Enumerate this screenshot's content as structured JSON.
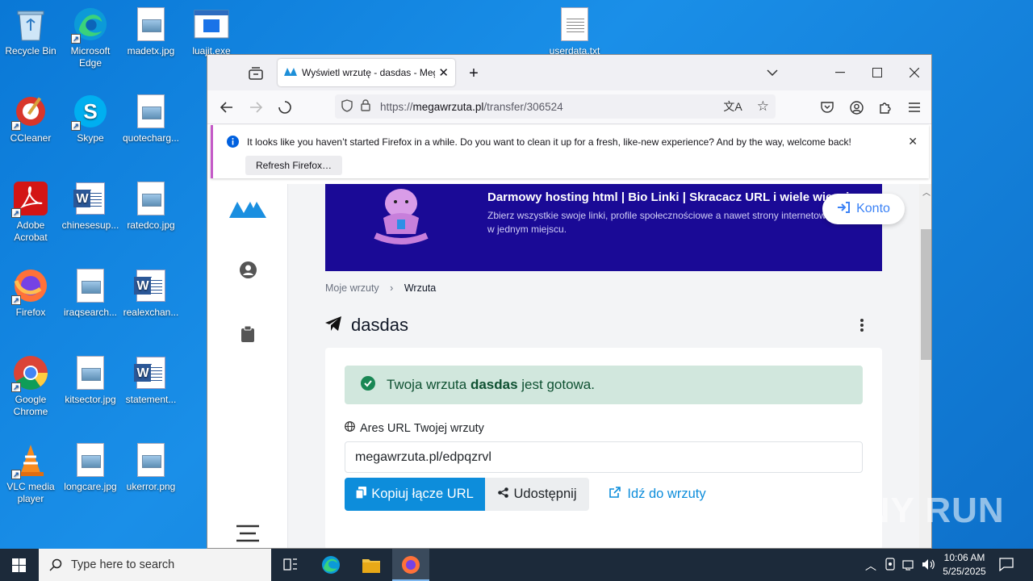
{
  "desktop": {
    "icons": [
      {
        "label": "Recycle Bin"
      },
      {
        "label": "Microsoft Edge"
      },
      {
        "label": "madetx.jpg"
      },
      {
        "label": "luajit.exe"
      },
      {
        "label": "userdata.txt"
      },
      {
        "label": "CCleaner"
      },
      {
        "label": "Skype"
      },
      {
        "label": "quotecharg..."
      },
      {
        "label": "Adobe Acrobat"
      },
      {
        "label": "chinesesup..."
      },
      {
        "label": "ratedco.jpg"
      },
      {
        "label": "Firefox"
      },
      {
        "label": "iraqsearch..."
      },
      {
        "label": "realexchan..."
      },
      {
        "label": "Google Chrome"
      },
      {
        "label": "kitsector.jpg"
      },
      {
        "label": "statement..."
      },
      {
        "label": "VLC media player"
      },
      {
        "label": "longcare.jpg"
      },
      {
        "label": "ukerror.png"
      }
    ]
  },
  "browser": {
    "tab_title": "Wyświetl wrzutę - dasdas - Meg",
    "url_prefix": "https://",
    "url_host": "megawrzuta.pl",
    "url_path": "/transfer/306524",
    "notification": "It looks like you haven’t started Firefox in a while. Do you want to clean it up for a fresh, like-new experience? And by the way, welcome back!",
    "refresh_button": "Refresh Firefox…"
  },
  "page": {
    "banner_title": "Darmowy hosting html | Bio Linki | Skracacz URL i wiele więcej",
    "banner_subtitle": "Zbierz wszystkie swoje linki, profile społecznościowe a nawet strony internetowe w jednym miejscu.",
    "konto_button": "Konto",
    "breadcrumb_parent": "Moje wrzuty",
    "breadcrumb_current": "Wrzuta",
    "title": "dasdas",
    "alert_prefix": "Twoja wrzuta",
    "alert_name": "dasdas",
    "alert_suffix": "jest gotowa.",
    "url_label_prefix": "Ares URL",
    "url_label_suffix": "Twojej wrzuty",
    "url_value": "megawrzuta.pl/edpqzrvl",
    "copy_button": "Kopiuj łącze URL",
    "share_button": "Udostępnij",
    "goto_button": "Idź do wrzuty"
  },
  "taskbar": {
    "search_placeholder": "Type here to search",
    "time": "10:06 AM",
    "date": "5/25/2025"
  },
  "watermark": "ANY RUN",
  "colors": {
    "desktop": "#0a78d6",
    "banner": "#1a0a96",
    "primary": "#0d8ddb",
    "alert_bg": "#d1e7dd"
  }
}
